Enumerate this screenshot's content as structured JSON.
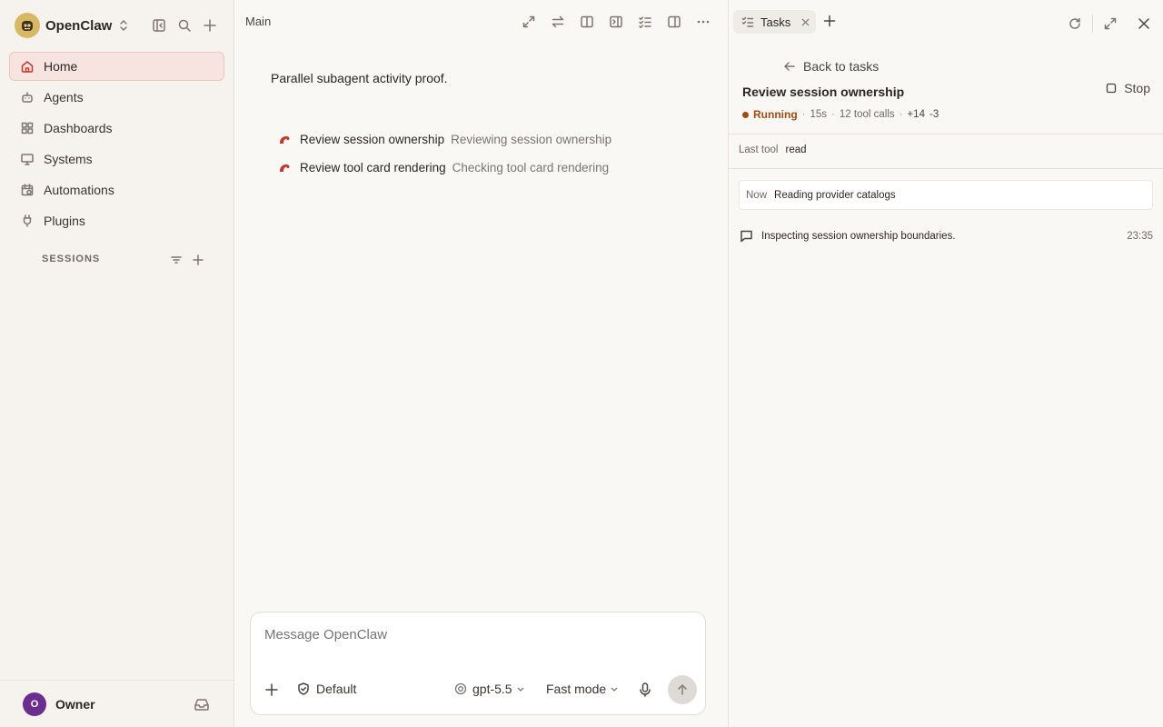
{
  "app": {
    "name": "OpenClaw"
  },
  "sidebar": {
    "items": [
      {
        "label": "Home",
        "icon": "home-icon",
        "active": true
      },
      {
        "label": "Agents",
        "icon": "agents-icon"
      },
      {
        "label": "Dashboards",
        "icon": "dashboards-icon"
      },
      {
        "label": "Systems",
        "icon": "monitor-icon"
      },
      {
        "label": "Automations",
        "icon": "automations-icon"
      },
      {
        "label": "Plugins",
        "icon": "plug-icon"
      }
    ],
    "sessions_header": "SESSIONS",
    "user": {
      "initial": "O",
      "name": "Owner"
    }
  },
  "main": {
    "title": "Main",
    "intro": "Parallel subagent activity proof.",
    "subagents": [
      {
        "name": "Review session ownership",
        "status": "Reviewing session ownership"
      },
      {
        "name": "Review tool card rendering",
        "status": "Checking tool card rendering"
      }
    ],
    "composer": {
      "placeholder": "Message OpenClaw",
      "permission": "Default",
      "model": "gpt-5.5",
      "mode": "Fast mode"
    }
  },
  "panel": {
    "tab_label": "Tasks",
    "back_label": "Back to tasks",
    "task_title": "Review session ownership",
    "stop_label": "Stop",
    "meta": {
      "status": "Running",
      "duration": "15s",
      "tool_calls": "12 tool calls",
      "added": "+14",
      "removed": "-3"
    },
    "last_tool": {
      "label": "Last tool",
      "value": "read"
    },
    "now": {
      "label": "Now",
      "value": "Reading provider catalogs"
    },
    "event": {
      "text": "Inspecting session ownership boundaries.",
      "time": "23:35"
    }
  },
  "colors": {
    "accent": "#c0392b",
    "running": "#a24a10",
    "active_bg": "#f7e4e0",
    "avatar": "#6b2d8f"
  }
}
